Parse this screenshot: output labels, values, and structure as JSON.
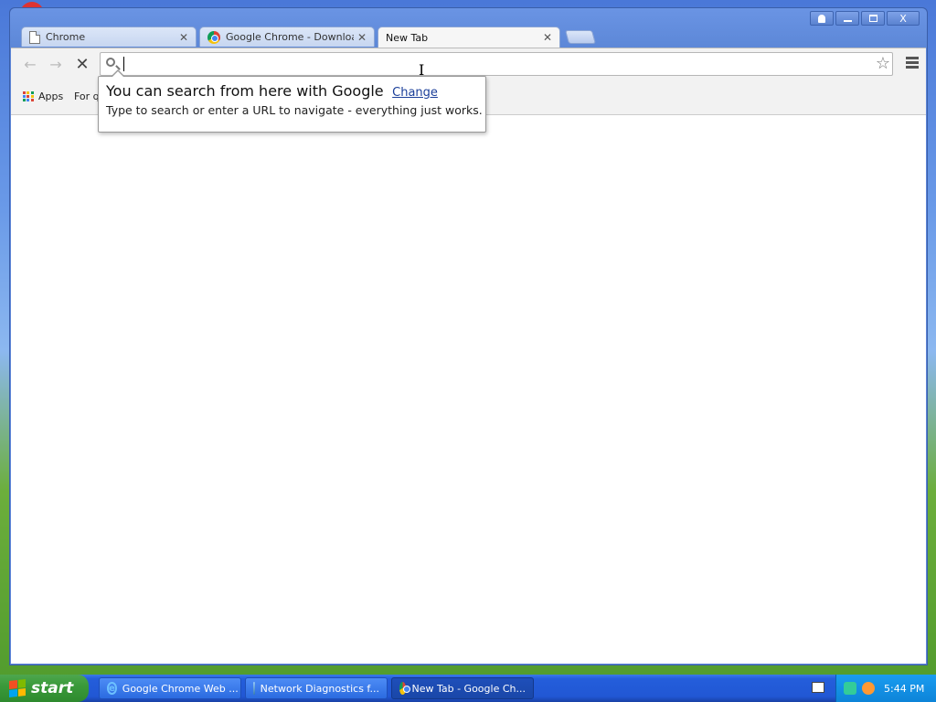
{
  "browser": {
    "tabs": [
      {
        "label": "Chrome",
        "icon": "page-icon"
      },
      {
        "label": "Google Chrome - Download t",
        "icon": "chrome-logo"
      },
      {
        "label": "New Tab",
        "icon": "none",
        "active": true
      }
    ],
    "close_glyph": "✕",
    "omnibox": {
      "value": "",
      "placeholder": ""
    },
    "bookmarks": {
      "apps_label": "Apps",
      "item_label": "For qu"
    },
    "bubble": {
      "title": "You can search from here with Google",
      "link": "Change",
      "subtitle": "Type to search or enter a URL to navigate - everything just works."
    }
  },
  "window_controls": {
    "close_glyph": "X"
  },
  "taskbar": {
    "start_label": "start",
    "tasks": [
      {
        "label": "Google Chrome Web ...",
        "icon": "ie-icon"
      },
      {
        "label": "Network Diagnostics f...",
        "icon": "network-icon"
      },
      {
        "label": "New Tab - Google Ch...",
        "icon": "chrome-logo",
        "active": true
      }
    ],
    "clock": "5:44 PM"
  },
  "colors": {
    "accent": "#245edb",
    "start_green": "#3a9a3a",
    "link": "#1a3e99"
  }
}
